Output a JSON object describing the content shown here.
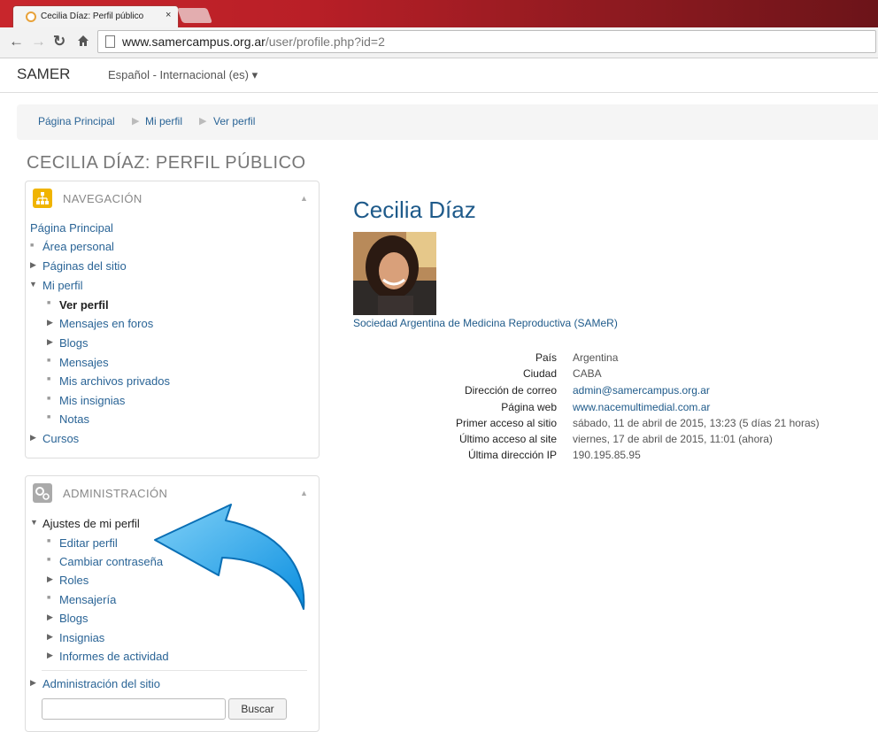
{
  "browser": {
    "tab_title": "Cecilia Díaz: Perfil público",
    "tab_close": "×",
    "url_host": "www.samercampus.org.ar",
    "url_path": "/user/profile.php?id=2"
  },
  "header": {
    "brand": "SAMER",
    "language": "Español - Internacional (es) ▾"
  },
  "breadcrumb": [
    "Página Principal",
    "Mi perfil",
    "Ver perfil"
  ],
  "page_title": "CECILIA DÍAZ: PERFIL PÚBLICO",
  "nav_block": {
    "title": "NAVEGACIÓN",
    "items": [
      "Página Principal",
      "Área personal",
      "Páginas del sitio",
      "Mi perfil",
      "Ver perfil",
      "Mensajes en foros",
      "Blogs",
      "Mensajes",
      "Mis archivos privados",
      "Mis insignias",
      "Notas",
      "Cursos"
    ]
  },
  "admin_block": {
    "title": "ADMINISTRACIÓN",
    "items": [
      "Ajustes de mi perfil",
      "Editar perfil",
      "Cambiar contraseña",
      "Roles",
      "Mensajería",
      "Blogs",
      "Insignias",
      "Informes de actividad",
      "Administración del sitio"
    ],
    "search_button": "Buscar"
  },
  "profile": {
    "name": "Cecilia Díaz",
    "organization": "Sociedad Argentina de Medicina Reproductiva (SAMeR)",
    "fields": [
      {
        "label": "País",
        "value": "Argentina"
      },
      {
        "label": "Ciudad",
        "value": "CABA"
      },
      {
        "label": "Dirección de correo",
        "value": "admin@samercampus.org.ar"
      },
      {
        "label": "Página web",
        "value": "www.nacemultimedial.com.ar"
      },
      {
        "label": "Primer acceso al sitio",
        "value": "sábado, 11 de abril de 2015, 13:23  (5 días 21 horas)"
      },
      {
        "label": "Último acceso al site",
        "value": "viernes, 17 de abril de 2015, 11:01  (ahora)"
      },
      {
        "label": "Última dirección IP",
        "value": "190.195.85.95"
      }
    ]
  },
  "colors": {
    "link": "#2a6496",
    "nav_icon": "#f0b400",
    "admin_icon": "#aaaaaa",
    "arrow": "#1aa3e8"
  }
}
